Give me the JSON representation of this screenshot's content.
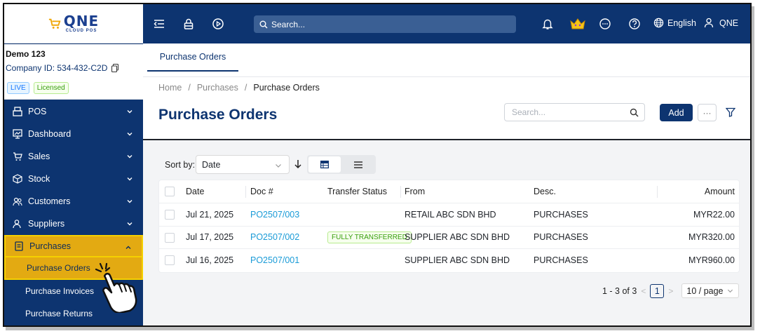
{
  "logo": {
    "brand": "QNE",
    "subtitle": "CLOUD POS"
  },
  "company": {
    "name": "Demo 123",
    "id_label": "Company ID: 534-432-C2D",
    "badge_live": "LIVE",
    "badge_licensed": "Licensed"
  },
  "sidebar": {
    "items": [
      {
        "label": "POS",
        "icon": "pos-terminal-icon"
      },
      {
        "label": "Dashboard",
        "icon": "dashboard-icon"
      },
      {
        "label": "Sales",
        "icon": "cart-icon"
      },
      {
        "label": "Stock",
        "icon": "cube-icon"
      },
      {
        "label": "Customers",
        "icon": "customers-icon"
      },
      {
        "label": "Suppliers",
        "icon": "suppliers-icon"
      },
      {
        "label": "Purchases",
        "icon": "purchases-icon"
      }
    ],
    "purchases_sub": [
      {
        "label": "Purchase Orders"
      },
      {
        "label": "Purchase Invoices"
      },
      {
        "label": "Purchase Returns"
      }
    ]
  },
  "topbar": {
    "search_placeholder": "Search...",
    "language": "English",
    "user": "QNE"
  },
  "tabs": [
    {
      "label": "Purchase Orders"
    }
  ],
  "breadcrumb": {
    "home": "Home",
    "section": "Purchases",
    "current": "Purchase Orders",
    "separator": "/"
  },
  "page": {
    "title": "Purchase Orders",
    "search_placeholder": "Search...",
    "add_label": "Add",
    "more_label": "···"
  },
  "sort": {
    "label": "Sort by:",
    "value": "Date"
  },
  "table": {
    "columns": {
      "date": "Date",
      "doc": "Doc #",
      "status": "Transfer Status",
      "from": "From",
      "desc": "Desc.",
      "amount": "Amount"
    },
    "rows": [
      {
        "date": "Jul 21, 2025",
        "doc": "PO2507/003",
        "status": "",
        "from": "RETAIL ABC SDN BHD",
        "desc": "PURCHASES",
        "amount": "MYR22.00"
      },
      {
        "date": "Jul 17, 2025",
        "doc": "PO2507/002",
        "status": "FULLY TRANSFERRED",
        "from": "SUPPLIER ABC SDN BHD",
        "desc": "PURCHASES",
        "amount": "MYR320.00"
      },
      {
        "date": "Jul 16, 2025",
        "doc": "PO2507/001",
        "status": "",
        "from": "SUPPLIER ABC SDN BHD",
        "desc": "PURCHASES",
        "amount": "MYR960.00"
      }
    ]
  },
  "pagination": {
    "range": "1 - 3 of 3",
    "current_page": "1",
    "page_size": "10 / page",
    "prev": "<",
    "next": ">"
  },
  "colors": {
    "navy": "#0d3470",
    "highlight": "#e3aa12",
    "link": "#1a9bd7"
  }
}
